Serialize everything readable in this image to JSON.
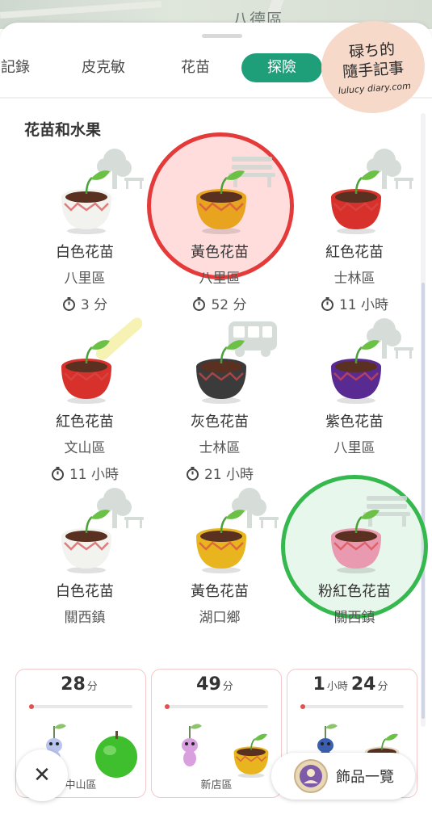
{
  "map": {
    "district_label": "八德區"
  },
  "watermark": {
    "line1": "碌ち的",
    "line2": "隨手記事",
    "line3": "lulucy diary.com"
  },
  "tabs": [
    {
      "label": "記錄",
      "active": false
    },
    {
      "label": "皮克敏",
      "active": false
    },
    {
      "label": "花苗",
      "active": false
    },
    {
      "label": "探險",
      "active": true
    }
  ],
  "section": {
    "title": "花苗和水果"
  },
  "colors": {
    "accent": "#1f9e7a",
    "highlight_red": "#e53a3a",
    "highlight_green": "#35b84e"
  },
  "seedlings": [
    {
      "name": "白色花苗",
      "area": "八里區",
      "timer": "3 分",
      "pot_color": "#f2f2ef",
      "deco": "tree-bench-icon"
    },
    {
      "name": "黃色花苗",
      "area": "八里區",
      "timer": "52 分",
      "pot_color": "#e8a31f",
      "deco": "bench-icon"
    },
    {
      "name": "紅色花苗",
      "area": "士林區",
      "timer": "11 小時",
      "pot_color": "#d8302a",
      "deco": "tree-bench-icon"
    },
    {
      "name": "紅色花苗",
      "area": "文山區",
      "timer": "11 小時",
      "pot_color": "#d8302a",
      "deco": "bread-icon"
    },
    {
      "name": "灰色花苗",
      "area": "士林區",
      "timer": "21 小時",
      "pot_color": "#3b3b3b",
      "deco": "bus-icon"
    },
    {
      "name": "紫色花苗",
      "area": "八里區",
      "timer": "",
      "pot_color": "#5a2a93",
      "deco": "tree-bench-icon"
    },
    {
      "name": "白色花苗",
      "area": "關西鎮",
      "timer": "",
      "pot_color": "#f2f2ef",
      "deco": "tree-bench-icon"
    },
    {
      "name": "黃色花苗",
      "area": "湖口鄉",
      "timer": "",
      "pot_color": "#e8b51f",
      "deco": "tree-bench-icon"
    },
    {
      "name": "粉紅色花苗",
      "area": "關西鎮",
      "timer": "",
      "pot_color": "#e99ab0",
      "deco": "bench-icon"
    }
  ],
  "expeditions": [
    {
      "time_big1": "28",
      "time_small1": "分",
      "time_big2": "",
      "time_small2": "",
      "location": "中山區",
      "progress": 0.03
    },
    {
      "time_big1": "49",
      "time_small1": "分",
      "time_big2": "",
      "time_small2": "",
      "location": "新店區",
      "progress": 0.03
    },
    {
      "time_big1": "1",
      "time_small1": "小時",
      "time_big2": "24",
      "time_small2": "分",
      "location": "",
      "progress": 0.03
    }
  ],
  "buttons": {
    "close_label": "✕",
    "accessories_label": "飾品一覽"
  }
}
